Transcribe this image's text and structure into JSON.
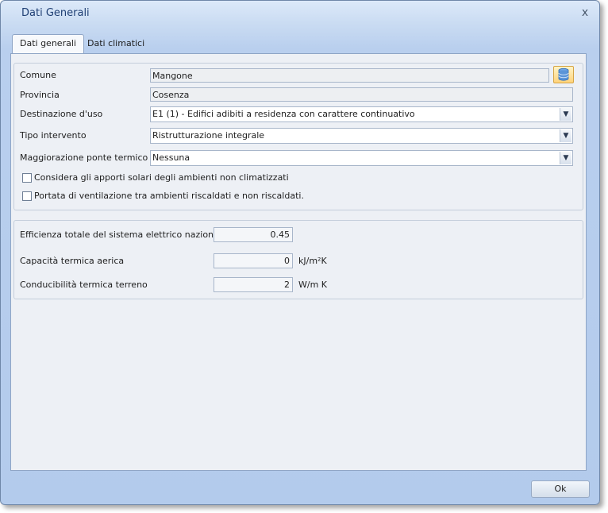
{
  "window": {
    "title": "Dati Generali",
    "close_glyph": "x"
  },
  "tabs": [
    {
      "label": "Dati generali",
      "active": true
    },
    {
      "label": "Dati climatici",
      "active": false
    }
  ],
  "general": {
    "comune": {
      "label": "Comune",
      "value": "Mangone",
      "button_icon": "database-icon"
    },
    "provincia": {
      "label": "Provincia",
      "value": "Cosenza"
    },
    "destinazione": {
      "label": "Destinazione d'uso",
      "value": "E1 (1) - Edifici adibiti a residenza con carattere continuativo"
    },
    "tipo_intervento": {
      "label": "Tipo intervento",
      "value": "Ristrutturazione integrale"
    },
    "maggiorazione": {
      "label": "Maggiorazione ponte termico",
      "value": "Nessuna"
    },
    "check_apporti": {
      "label": "Considera gli apporti solari degli ambienti non climatizzati",
      "checked": false
    },
    "check_portata": {
      "label": "Portata di ventilazione tra ambienti riscaldati e non riscaldati.",
      "checked": false
    }
  },
  "parameters": {
    "efficienza": {
      "label": "Efficienza totale del sistema elettrico nazionale",
      "value": "0.45",
      "unit": ""
    },
    "capacita": {
      "label": "Capacità termica aerica",
      "value": "0",
      "unit": "kJ/m²K"
    },
    "conducibilita": {
      "label": "Conducibilità termica terreno",
      "value": "2",
      "unit": "W/m K"
    }
  },
  "footer": {
    "ok_label": "Ok"
  },
  "colors": {
    "title_text": "#1f3f74",
    "frame": "#b3cbec",
    "panel": "#edf0f5",
    "db_button": "#ffd37a"
  }
}
